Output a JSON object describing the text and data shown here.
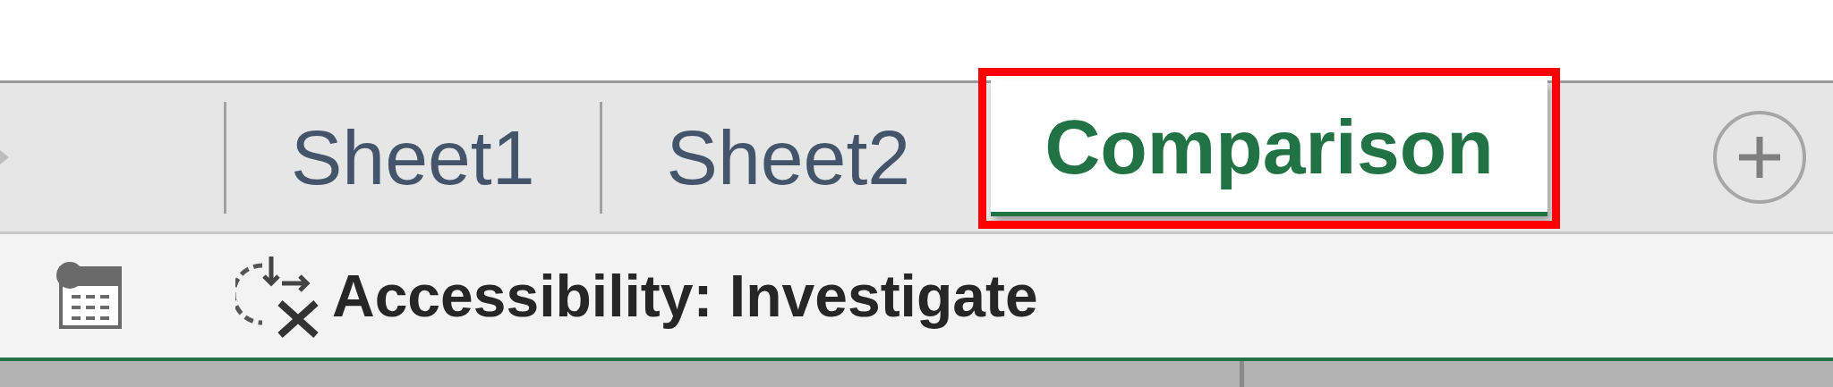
{
  "tabs": [
    {
      "label": "Sheet1",
      "selected": false,
      "highlighted": false
    },
    {
      "label": "Sheet2",
      "selected": false,
      "highlighted": false
    },
    {
      "label": "Comparison",
      "selected": true,
      "highlighted": true
    }
  ],
  "status_bar": {
    "accessibility": "Accessibility: Investigate"
  }
}
